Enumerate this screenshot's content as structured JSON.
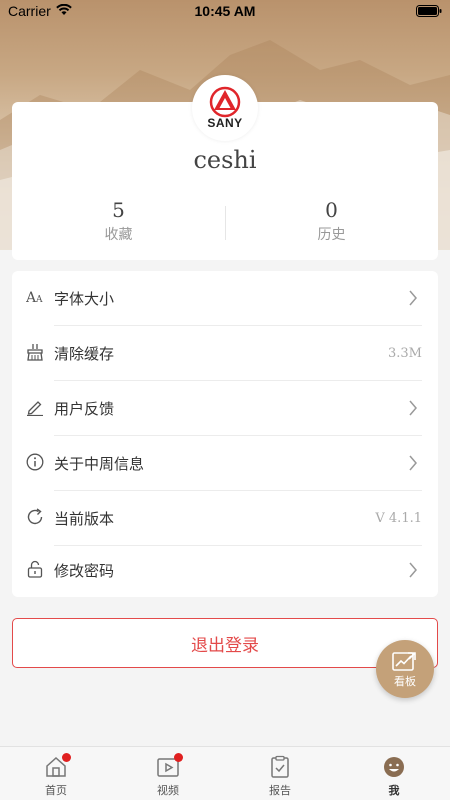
{
  "status_bar": {
    "carrier": "Carrier",
    "time": "10:45 AM"
  },
  "profile": {
    "logo_text": "SANY",
    "username": "ceshi",
    "stats": [
      {
        "value": "5",
        "label": "收藏"
      },
      {
        "value": "0",
        "label": "历史"
      }
    ]
  },
  "menu": {
    "items": [
      {
        "label": "字体大小",
        "icon": "font-size-icon",
        "value": ""
      },
      {
        "label": "清除缓存",
        "icon": "broom-icon",
        "value": "3.3M"
      },
      {
        "label": "用户反馈",
        "icon": "pen-icon",
        "value": ""
      },
      {
        "label": "关于中周信息",
        "icon": "info-icon",
        "value": ""
      },
      {
        "label": "当前版本",
        "icon": "refresh-icon",
        "value": "V 4.1.1"
      },
      {
        "label": "修改密码",
        "icon": "lock-icon",
        "value": ""
      }
    ]
  },
  "logout_label": "退出登录",
  "fab_label": "看板",
  "tabbar": {
    "tabs": [
      {
        "label": "首页",
        "icon": "home-icon",
        "badge": true
      },
      {
        "label": "视频",
        "icon": "video-icon",
        "badge": true
      },
      {
        "label": "报告",
        "icon": "report-icon",
        "badge": false
      },
      {
        "label": "我",
        "icon": "me-icon",
        "badge": false,
        "active": true
      }
    ]
  },
  "colors": {
    "accent": "#e34a4a",
    "gold": "#c4a179",
    "badge": "#e02020"
  }
}
